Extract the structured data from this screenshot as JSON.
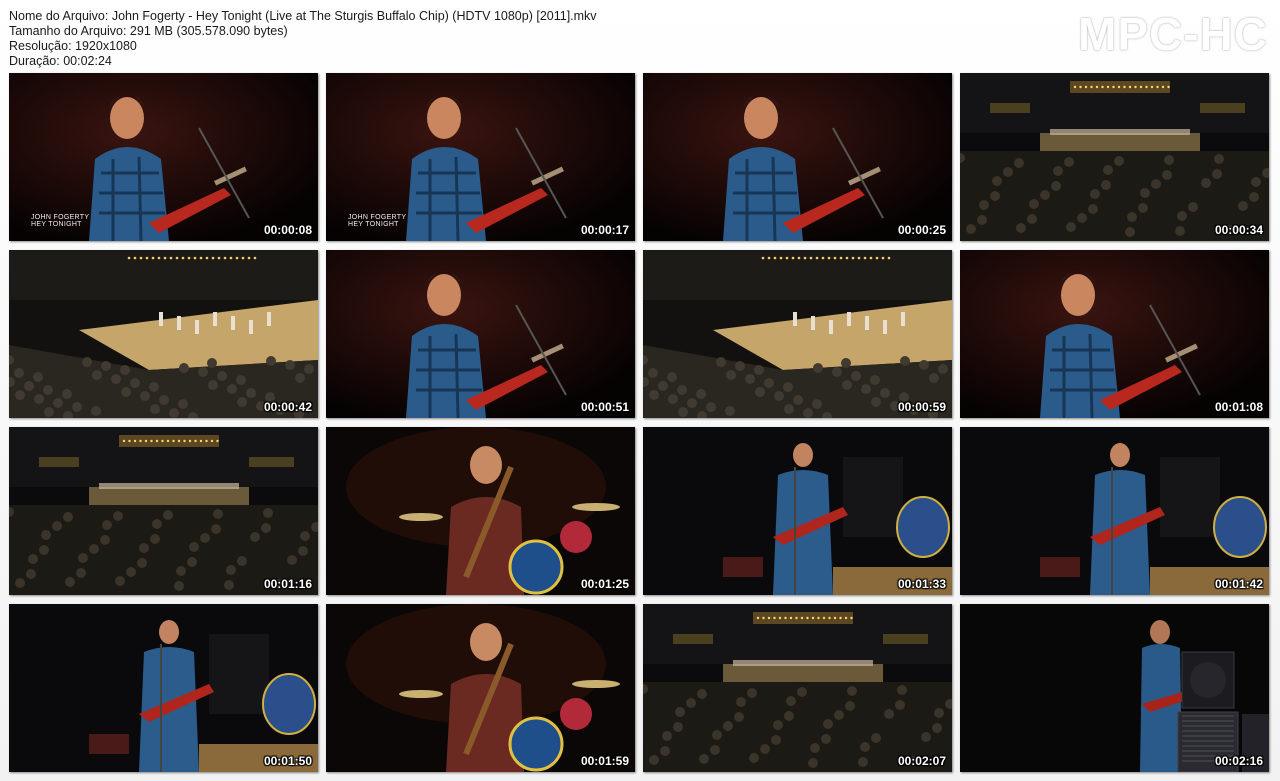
{
  "header": {
    "filename": "Nome do Arquivo: John Fogerty - Hey Tonight (Live at The Sturgis Buffalo Chip) (HDTV 1080p) [2011].mkv",
    "filesize": "Tamanho do Arquivo: 291 MB (305.578.090 bytes)",
    "resolution": "Resolução: 1920x1080",
    "duration": "Duração: 00:02:24"
  },
  "logo": "MPC-HC",
  "thumbnails": [
    {
      "time": "00:00:08",
      "scene": "closeup",
      "caption": "JOHN FOGERTY\nHEY TONIGHT"
    },
    {
      "time": "00:00:17",
      "scene": "closeup",
      "caption": "JOHN FOGERTY\nHEY TONIGHT"
    },
    {
      "time": "00:00:25",
      "scene": "closeup"
    },
    {
      "time": "00:00:34",
      "scene": "wide"
    },
    {
      "time": "00:00:42",
      "scene": "stage"
    },
    {
      "time": "00:00:51",
      "scene": "closeup"
    },
    {
      "time": "00:00:59",
      "scene": "stage"
    },
    {
      "time": "00:01:08",
      "scene": "closeup"
    },
    {
      "time": "00:01:16",
      "scene": "wide"
    },
    {
      "time": "00:01:25",
      "scene": "drums"
    },
    {
      "time": "00:01:33",
      "scene": "band"
    },
    {
      "time": "00:01:42",
      "scene": "band"
    },
    {
      "time": "00:01:50",
      "scene": "band"
    },
    {
      "time": "00:01:59",
      "scene": "drums"
    },
    {
      "time": "00:02:07",
      "scene": "wide"
    },
    {
      "time": "00:02:16",
      "scene": "amp"
    }
  ]
}
